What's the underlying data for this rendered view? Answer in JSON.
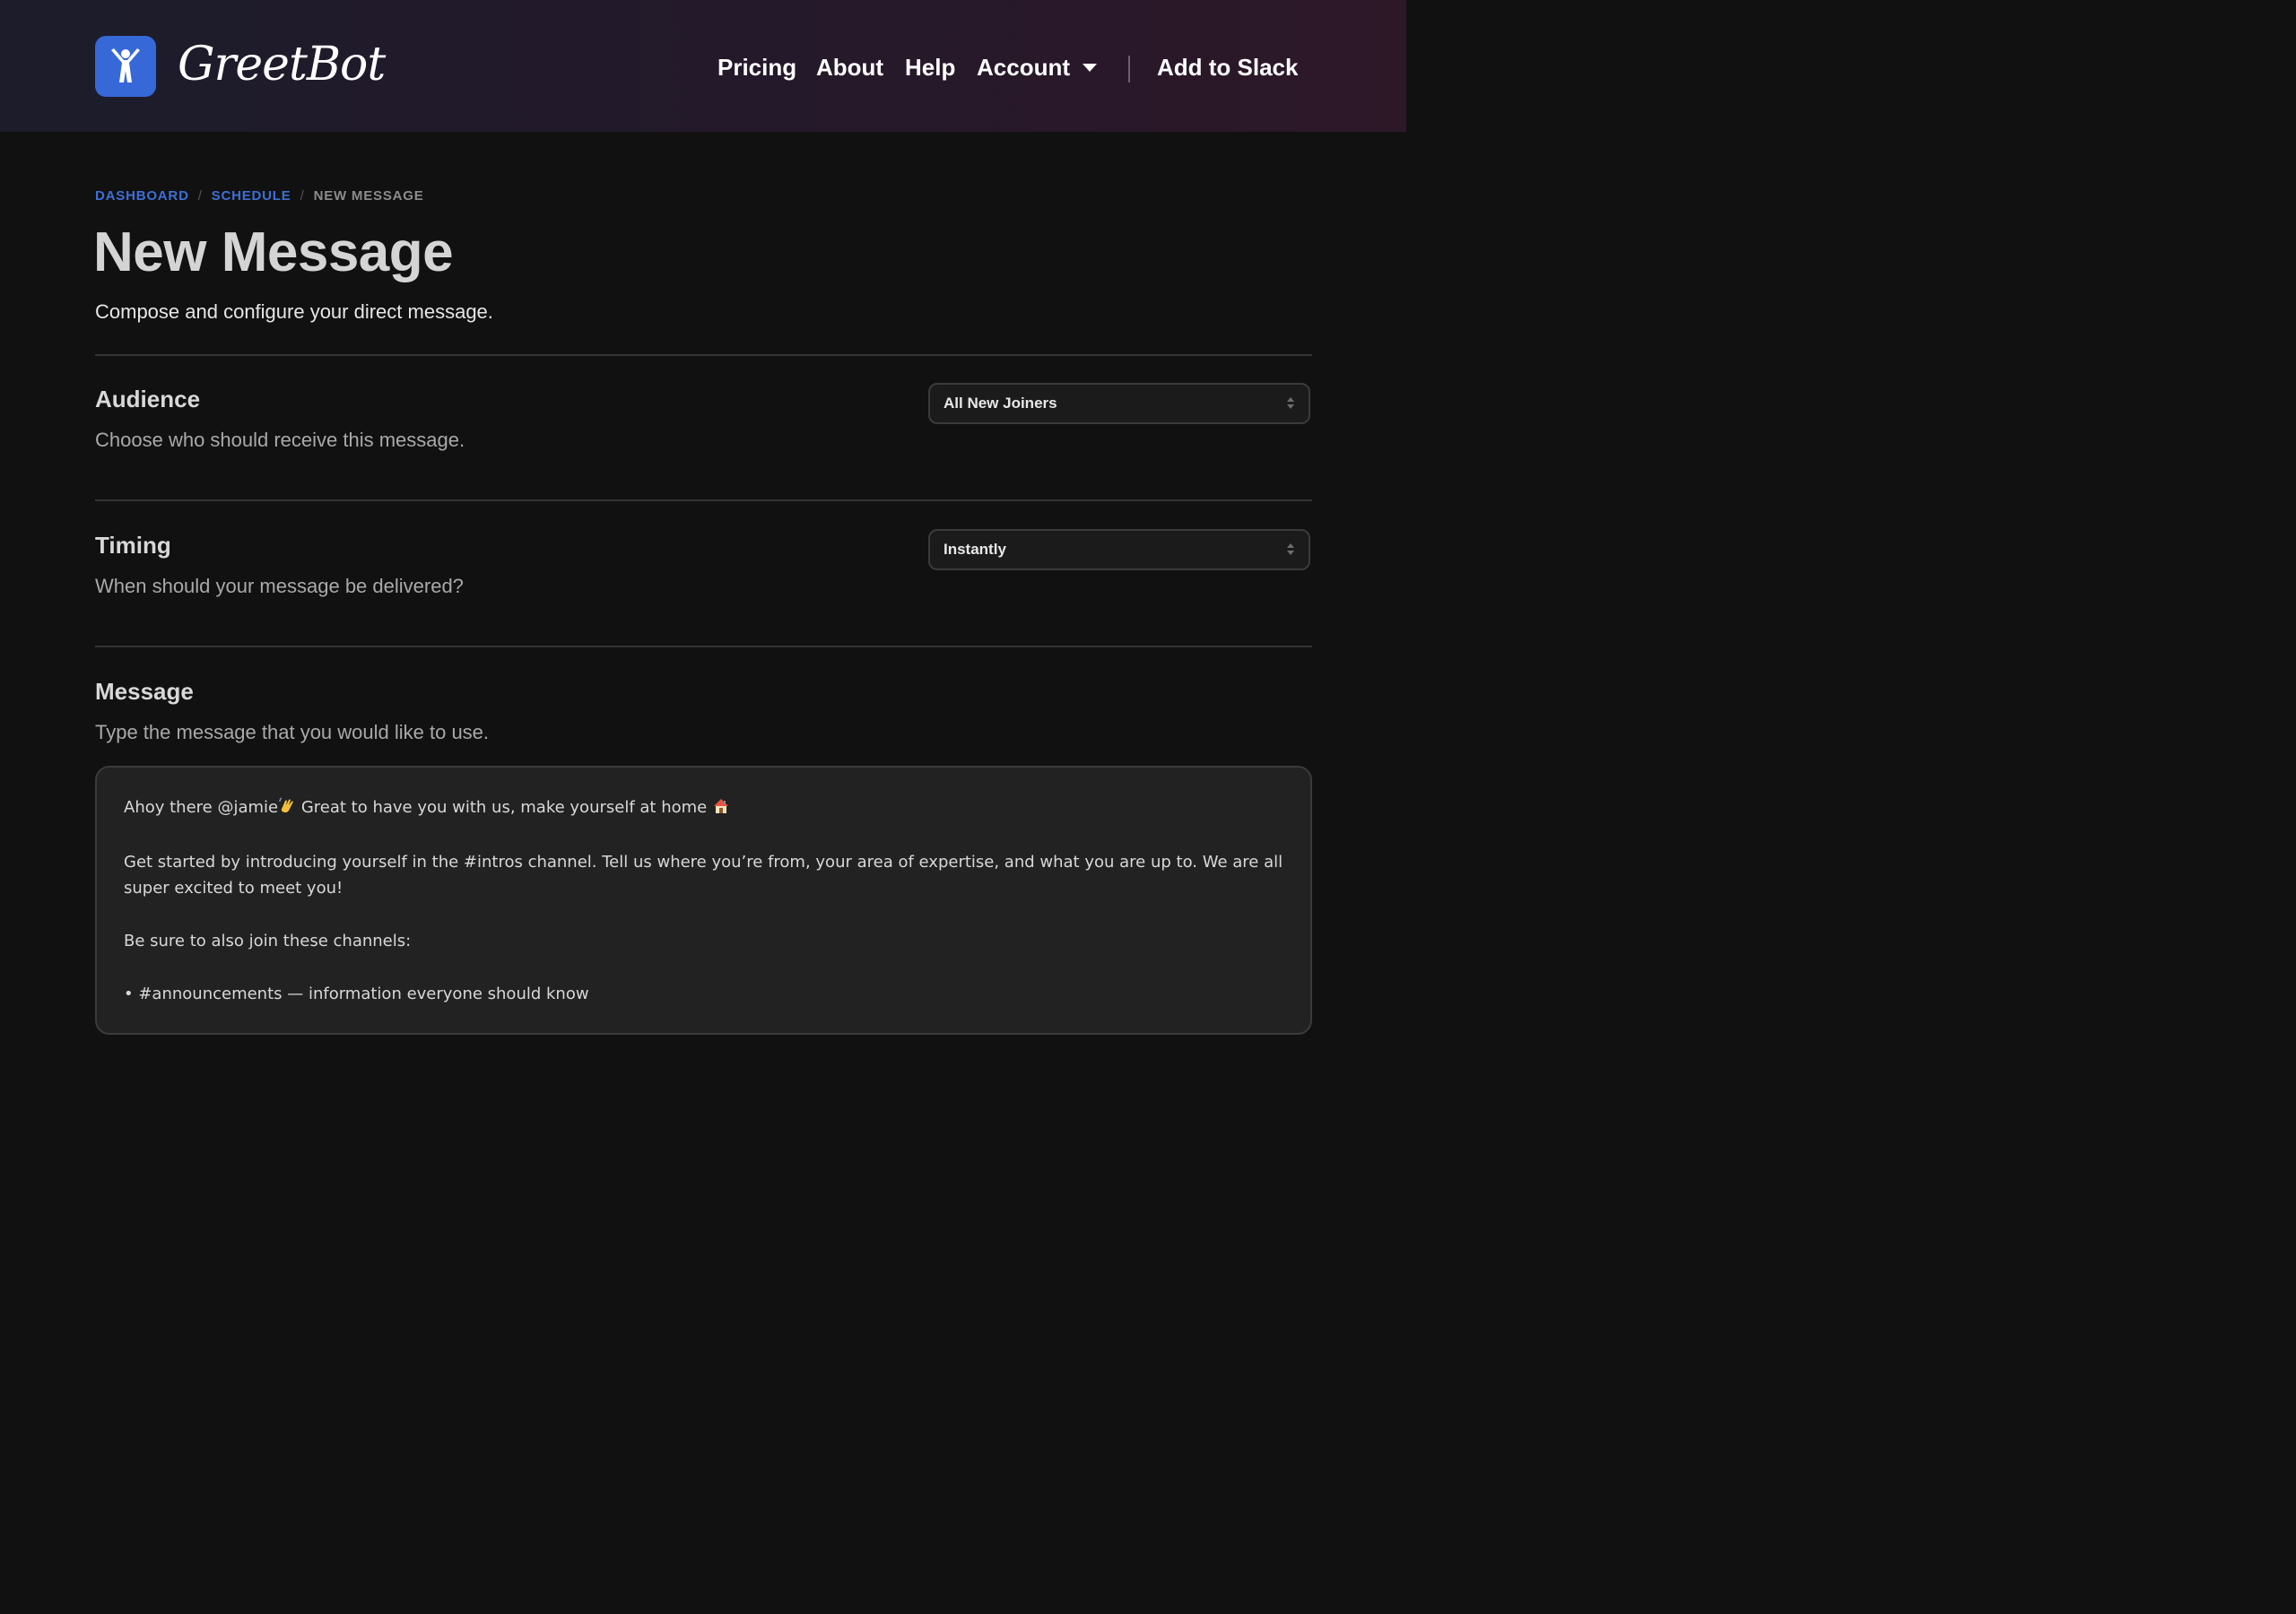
{
  "header": {
    "brand": "GreetBot",
    "nav": {
      "pricing": "Pricing",
      "about": "About",
      "help": "Help",
      "account": "Account",
      "add_to_slack": "Add to Slack"
    }
  },
  "breadcrumb": {
    "items": [
      "DASHBOARD",
      "SCHEDULE",
      "NEW MESSAGE"
    ],
    "separator": "/"
  },
  "page": {
    "title": "New Message",
    "subtitle": "Compose and configure your direct message."
  },
  "sections": {
    "audience": {
      "title": "Audience",
      "description": "Choose who should receive this message.",
      "selected": "All New Joiners"
    },
    "timing": {
      "title": "Timing",
      "description": "When should your message be delivered?",
      "selected": "Instantly"
    },
    "message": {
      "title": "Message",
      "description": "Type the message that you would like to use.",
      "body": {
        "line1": "Ahoy there @jamie",
        "line1_rest": " Great to have you with us, make yourself at home ",
        "paragraph2": "Get started by introducing yourself in the #intros channel. Tell us where you’re from, your area of expertise, and what you are up to. We are all super excited to meet you!",
        "paragraph3": "Be sure to also join these channels:",
        "list_item1": "• #announcements — information everyone should know"
      }
    }
  },
  "colors": {
    "accent": "#3668d8",
    "link": "#3d6fd8",
    "background": "#111111",
    "header_gradient_start": "#1c1c2a",
    "header_gradient_end": "#2d1828"
  },
  "icons": {
    "logo": "person-arms-raised-icon",
    "account_caret": "chevron-down-icon",
    "select_arrows": "select-updown-icon",
    "wave": "waving-hand-emoji",
    "home": "house-emoji"
  }
}
